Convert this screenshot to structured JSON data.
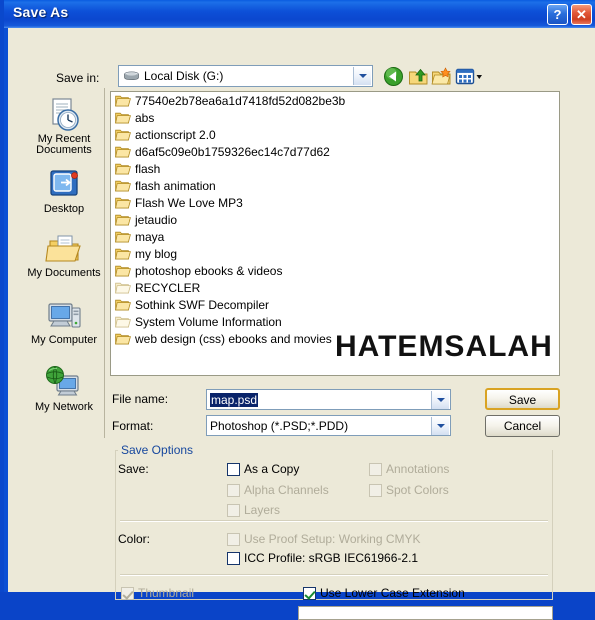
{
  "window": {
    "title": "Save As",
    "help_button": "?",
    "close_button": "✕"
  },
  "toolbar": {
    "save_in_label": "Save in:",
    "save_in_value": "Local Disk (G:)",
    "back_icon": "back-arrow-icon",
    "up_icon": "up-one-level-icon",
    "new_folder_icon": "new-folder-icon",
    "views_icon": "views-dropdown-icon"
  },
  "places": [
    {
      "label_line1": "My Recent",
      "label_line2": "Documents",
      "icon": "recent-documents-icon"
    },
    {
      "label_line1": "Desktop",
      "label_line2": "",
      "icon": "desktop-icon"
    },
    {
      "label_line1": "My Documents",
      "label_line2": "",
      "icon": "my-documents-icon"
    },
    {
      "label_line1": "My Computer",
      "label_line2": "",
      "icon": "my-computer-icon"
    },
    {
      "label_line1": "My Network",
      "label_line2": "",
      "icon": "my-network-icon"
    }
  ],
  "file_list": {
    "items": [
      {
        "name": "77540e2b78ea6a1d7418fd52d082be3b",
        "icon": "folder-icon",
        "system": false
      },
      {
        "name": "abs",
        "icon": "folder-icon",
        "system": false
      },
      {
        "name": "actionscript 2.0",
        "icon": "folder-icon",
        "system": false
      },
      {
        "name": "d6af5c09e0b1759326ec14c7d77d62",
        "icon": "folder-icon",
        "system": false
      },
      {
        "name": "flash",
        "icon": "folder-icon",
        "system": false
      },
      {
        "name": "flash animation",
        "icon": "folder-icon",
        "system": false
      },
      {
        "name": "Flash We Love MP3",
        "icon": "folder-icon",
        "system": false
      },
      {
        "name": "jetaudio",
        "icon": "folder-icon",
        "system": false
      },
      {
        "name": "maya",
        "icon": "folder-icon",
        "system": false
      },
      {
        "name": "my blog",
        "icon": "folder-icon",
        "system": false
      },
      {
        "name": "photoshop ebooks & videos",
        "icon": "folder-icon",
        "system": false
      },
      {
        "name": "RECYCLER",
        "icon": "folder-icon",
        "system": true
      },
      {
        "name": "Sothink SWF Decompiler",
        "icon": "folder-icon",
        "system": false
      },
      {
        "name": "System Volume Information",
        "icon": "folder-icon",
        "system": true
      },
      {
        "name": "web design (css) ebooks and movies",
        "icon": "folder-icon",
        "system": false
      }
    ],
    "watermark": "HATEMSALAH"
  },
  "fields": {
    "file_name_label": "File name:",
    "file_name_value": "map.psd",
    "format_label": "Format:",
    "format_value": "Photoshop (*.PSD;*.PDD)"
  },
  "buttons": {
    "save": "Save",
    "cancel": "Cancel"
  },
  "save_options": {
    "group_title": "Save Options",
    "save_label": "Save:",
    "color_label": "Color:",
    "checkboxes": {
      "as_a_copy": "As a Copy",
      "alpha_channels": "Alpha Channels",
      "layers": "Layers",
      "annotations": "Annotations",
      "spot_colors": "Spot Colors",
      "use_proof_setup": "Use Proof Setup:  Working CMYK",
      "icc_profile": "ICC Profile:  sRGB IEC61966-2.1",
      "thumbnail": "Thumbnail",
      "lower_case_extension": "Use Lower Case Extension"
    }
  },
  "colors": {
    "titlebar_blue": "#0b4fd4",
    "dialog_face": "#ece9d8",
    "group_label_blue": "#16479e",
    "selection_blue": "#0a246a",
    "focus_gold": "#d9a323",
    "check_green": "#1a8a32",
    "disabled_grey": "#b0ac9a"
  }
}
